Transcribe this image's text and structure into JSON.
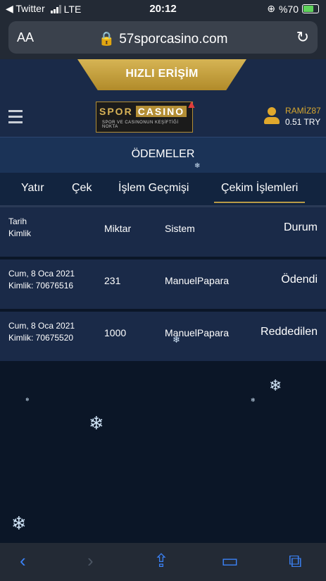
{
  "status_bar": {
    "back_app": "◀ Twitter",
    "carrier": "LTE",
    "time": "20:12",
    "battery": "%70"
  },
  "browser": {
    "aa": "AA",
    "url": "57sporcasino.com"
  },
  "header": {
    "quick_access": "HIZLI ERİŞİM",
    "logo": {
      "spor": "SPOR",
      "casino": "CASINO",
      "tagline": "SPOR VE CASINONUN KEŞİFTİĞİ NOKTA"
    },
    "user": {
      "name": "RAMİZ87",
      "balance": "0.51 TRY"
    }
  },
  "page_title": "ÖDEMELER",
  "tabs": [
    {
      "label": "Yatır"
    },
    {
      "label": "Çek"
    },
    {
      "label": "İşlem Geçmişi"
    },
    {
      "label": "Çekim İşlemleri",
      "active": true
    }
  ],
  "table": {
    "headers": {
      "date": "Tarih",
      "id": "Kimlik",
      "amount": "Miktar",
      "system": "Sistem",
      "status": "Durum"
    },
    "rows": [
      {
        "date": "Cum, 8 Oca 2021",
        "id": "Kimlik: 70676516",
        "amount": "231",
        "system": "ManuelPapara",
        "status": "Ödendi"
      },
      {
        "date": "Cum, 8 Oca 2021",
        "id": "Kimlik: 70675520",
        "amount": "1000",
        "system": "ManuelPapara",
        "status": "Reddedilen"
      }
    ]
  },
  "toolbar_icons": [
    "back-icon",
    "forward-icon",
    "share-icon",
    "bookmarks-icon",
    "tabs-icon"
  ]
}
